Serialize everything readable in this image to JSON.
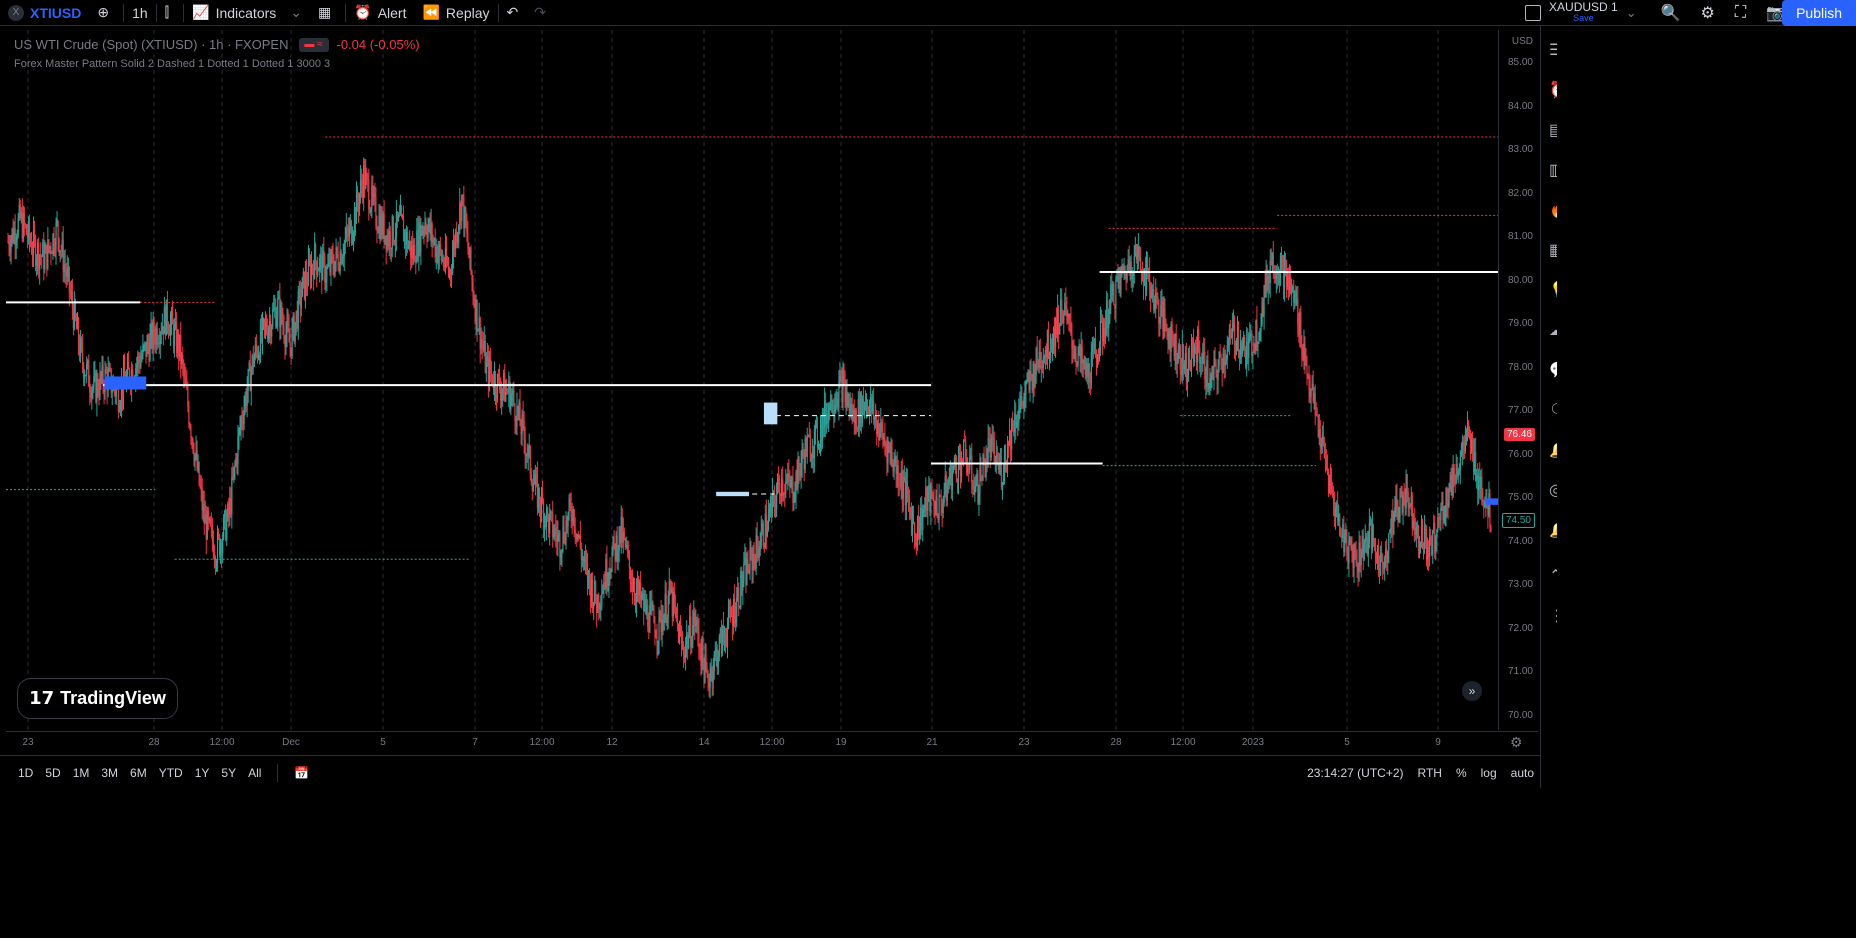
{
  "toolbar": {
    "symbol": "XTIUSD",
    "symbol_badge": "X",
    "interval": "1h",
    "indicators_label": "Indicators",
    "alert_label": "Alert",
    "replay_label": "Replay",
    "compare_symbol": "XAUDUSD 1",
    "save_label": "Save",
    "publish_label": "Publish"
  },
  "legend": {
    "title": "US WTI Crude (Spot) (XTIUSD) · 1h · FXOPEN",
    "change": "-0.04 (-0.05%)",
    "indicator": "Forex Master Pattern Solid 2 Dashed 1 Dotted 1 Dotted 1 3000 3"
  },
  "price_axis": {
    "currency": "USD",
    "labels": [
      "85.00",
      "84.00",
      "83.00",
      "82.00",
      "81.00",
      "80.00",
      "79.00",
      "78.00",
      "77.00",
      "76.00",
      "75.00",
      "74.00",
      "73.00",
      "72.00",
      "71.00",
      "70.00"
    ],
    "current_price": "76.46",
    "current_price_color": "#f23645",
    "last_price": "74.50",
    "last_price_color": "#26a69a"
  },
  "time_axis": {
    "labels": [
      "23",
      "28",
      "12:00",
      "Dec",
      "5",
      "7",
      "12:00",
      "12",
      "14",
      "12:00",
      "19",
      "21",
      "23",
      "28",
      "12:00",
      "2023",
      "5",
      "9"
    ]
  },
  "ranges": [
    "1D",
    "5D",
    "1M",
    "3M",
    "6M",
    "YTD",
    "1Y",
    "5Y",
    "All"
  ],
  "status": {
    "clock": "23:14:27 (UTC+2)",
    "session": "RTH",
    "percent": "%",
    "log": "log",
    "auto": "auto"
  },
  "logo_text": "TradingView",
  "colors": {
    "up": "#26a69a",
    "down": "#f23645",
    "accent": "#2962ff"
  },
  "chart_data": {
    "type": "candlestick",
    "symbol": "XTIUSD",
    "interval": "1h",
    "ylim": [
      70.0,
      85.0
    ],
    "close_path": [
      [
        0,
        80.9
      ],
      [
        1,
        81.4
      ],
      [
        2,
        80.8
      ],
      [
        3,
        80.5
      ],
      [
        4,
        81.2
      ],
      [
        5,
        79.8
      ],
      [
        6,
        78.2
      ],
      [
        7,
        77.5
      ],
      [
        8,
        77.8
      ],
      [
        9,
        77.4
      ],
      [
        10,
        77.9
      ],
      [
        11,
        78.3
      ],
      [
        12,
        78.8
      ],
      [
        13,
        79.2
      ],
      [
        14,
        78.4
      ],
      [
        15,
        76.5
      ],
      [
        16,
        74.5
      ],
      [
        17,
        73.8
      ],
      [
        18,
        74.6
      ],
      [
        19,
        76.8
      ],
      [
        20,
        78.2
      ],
      [
        21,
        78.9
      ],
      [
        22,
        79.4
      ],
      [
        23,
        78.5
      ],
      [
        24,
        79.8
      ],
      [
        25,
        80.5
      ],
      [
        26,
        80.2
      ],
      [
        27,
        80.6
      ],
      [
        28,
        81.2
      ],
      [
        29,
        82.4
      ],
      [
        30,
        81.5
      ],
      [
        31,
        81.0
      ],
      [
        32,
        81.3
      ],
      [
        33,
        80.6
      ],
      [
        34,
        81.4
      ],
      [
        35,
        80.7
      ],
      [
        36,
        80.2
      ],
      [
        37,
        81.9
      ],
      [
        38,
        79.6
      ],
      [
        39,
        78.0
      ],
      [
        40,
        77.6
      ],
      [
        41,
        77.4
      ],
      [
        42,
        76.5
      ],
      [
        43,
        75.2
      ],
      [
        44,
        74.5
      ],
      [
        45,
        74.0
      ],
      [
        46,
        74.8
      ],
      [
        47,
        73.4
      ],
      [
        48,
        72.6
      ],
      [
        49,
        73.5
      ],
      [
        50,
        74.2
      ],
      [
        51,
        73.0
      ],
      [
        52,
        72.4
      ],
      [
        53,
        72.0
      ],
      [
        54,
        72.8
      ],
      [
        55,
        71.5
      ],
      [
        56,
        72.2
      ],
      [
        57,
        70.8
      ],
      [
        58,
        71.6
      ],
      [
        59,
        72.3
      ],
      [
        60,
        73.2
      ],
      [
        61,
        73.8
      ],
      [
        62,
        74.5
      ],
      [
        63,
        75.4
      ],
      [
        64,
        75.2
      ],
      [
        65,
        76.1
      ],
      [
        66,
        76.4
      ],
      [
        67,
        77.2
      ],
      [
        68,
        77.6
      ],
      [
        69,
        76.8
      ],
      [
        70,
        77.3
      ],
      [
        71,
        76.6
      ],
      [
        72,
        76.0
      ],
      [
        73,
        75.3
      ],
      [
        74,
        74.2
      ],
      [
        75,
        75.0
      ],
      [
        76,
        74.8
      ],
      [
        77,
        75.6
      ],
      [
        78,
        76.0
      ],
      [
        79,
        75.2
      ],
      [
        80,
        76.2
      ],
      [
        81,
        75.6
      ],
      [
        82,
        76.8
      ],
      [
        83,
        77.4
      ],
      [
        84,
        78.2
      ],
      [
        85,
        78.6
      ],
      [
        86,
        79.4
      ],
      [
        87,
        78.4
      ],
      [
        88,
        77.8
      ],
      [
        89,
        78.6
      ],
      [
        90,
        79.6
      ],
      [
        91,
        80.2
      ],
      [
        92,
        80.6
      ],
      [
        93,
        80.0
      ],
      [
        94,
        79.2
      ],
      [
        95,
        78.6
      ],
      [
        96,
        78.0
      ],
      [
        97,
        78.5
      ],
      [
        98,
        77.6
      ],
      [
        99,
        78.2
      ],
      [
        100,
        78.8
      ],
      [
        101,
        78.3
      ],
      [
        102,
        79.0
      ],
      [
        103,
        80.5
      ],
      [
        104,
        80.2
      ],
      [
        105,
        79.5
      ],
      [
        106,
        77.8
      ],
      [
        107,
        76.4
      ],
      [
        108,
        75.0
      ],
      [
        109,
        74.0
      ],
      [
        110,
        73.6
      ],
      [
        111,
        74.2
      ],
      [
        112,
        73.4
      ],
      [
        113,
        74.6
      ],
      [
        114,
        75.2
      ],
      [
        115,
        74.2
      ],
      [
        116,
        73.8
      ],
      [
        117,
        74.8
      ],
      [
        118,
        75.6
      ],
      [
        119,
        76.4
      ],
      [
        120,
        75.4
      ],
      [
        121,
        74.5
      ]
    ],
    "levels": [
      {
        "price": 83.3,
        "style": "dotted",
        "color": "#f23645",
        "from": 0.214,
        "to": 1.0
      },
      {
        "price": 81.5,
        "style": "dotted",
        "color": "#f23645",
        "from": 0.852,
        "to": 1.0
      },
      {
        "price": 81.2,
        "style": "dotted",
        "color": "#f23645",
        "from": 0.739,
        "to": 0.852
      },
      {
        "price": 79.5,
        "style": "solid",
        "color": "#ffffff",
        "from": 0.0,
        "to": 0.09
      },
      {
        "price": 79.5,
        "style": "dotted",
        "color": "#f23645",
        "from": 0.09,
        "to": 0.14
      },
      {
        "price": 80.2,
        "style": "solid",
        "color": "#ffffff",
        "from": 0.733,
        "to": 1.0
      },
      {
        "price": 77.6,
        "style": "solid",
        "color": "#ffffff",
        "from": 0.065,
        "to": 0.62
      },
      {
        "price": 76.9,
        "style": "dashed",
        "color": "#ffffff",
        "from": 0.51,
        "to": 0.62
      },
      {
        "price": 75.8,
        "style": "solid",
        "color": "#ffffff",
        "from": 0.62,
        "to": 0.735
      },
      {
        "price": 75.75,
        "style": "dotted",
        "color": "#26a69a",
        "from": 0.735,
        "to": 0.878
      },
      {
        "price": 76.9,
        "style": "dotted",
        "color": "#26a69a",
        "from": 0.787,
        "to": 0.862
      },
      {
        "price": 75.2,
        "style": "dotted",
        "color": "#26a69a",
        "from": 0.0,
        "to": 0.1
      },
      {
        "price": 75.1,
        "style": "dashed",
        "color": "#ffffff",
        "from": 0.476,
        "to": 0.515
      },
      {
        "price": 73.6,
        "style": "dotted",
        "color": "#26a69a",
        "from": 0.113,
        "to": 0.31
      }
    ],
    "boxes": [
      {
        "price_top": 77.8,
        "price_bottom": 77.5,
        "from": 0.066,
        "to": 0.094,
        "color": "#2962ff"
      },
      {
        "price_top": 77.2,
        "price_bottom": 76.7,
        "from": 0.508,
        "to": 0.517,
        "color": "#bbdefb"
      },
      {
        "price_top": 75.15,
        "price_bottom": 75.05,
        "from": 0.476,
        "to": 0.498,
        "color": "#bbdefb"
      },
      {
        "price_top": 75.0,
        "price_bottom": 74.85,
        "from": 0.992,
        "to": 1.0,
        "color": "#2962ff"
      }
    ]
  }
}
